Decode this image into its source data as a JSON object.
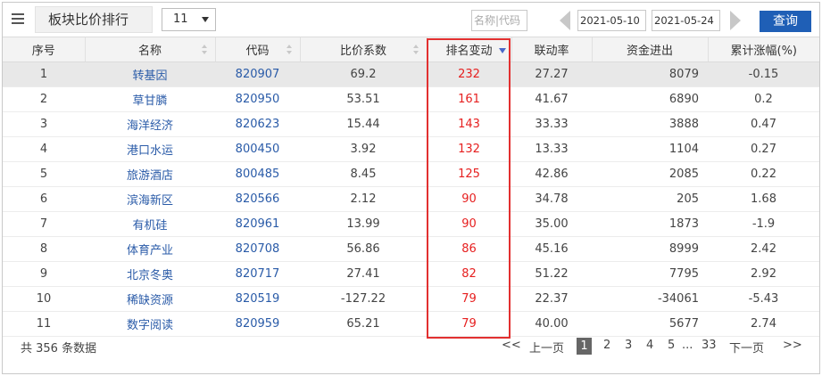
{
  "toolbar": {
    "menu_icon": "list-icon",
    "title": "板块比价排行",
    "page_size": "11",
    "search_placeholder": "名称|代码",
    "date_start": "2021-05-10",
    "date_end": "2021-05-24",
    "query_label": "查询"
  },
  "table": {
    "headers": [
      "序号",
      "名称",
      "代码",
      "比价系数",
      "排名变动",
      "联动率",
      "资金进出",
      "累计涨幅(%)"
    ],
    "rows": [
      [
        "1",
        "转基因",
        "820907",
        "69.2",
        "232",
        "27.27",
        "8079",
        "-0.15"
      ],
      [
        "2",
        "草甘膦",
        "820950",
        "53.51",
        "161",
        "41.67",
        "6890",
        "0.2"
      ],
      [
        "3",
        "海洋经济",
        "820623",
        "15.44",
        "143",
        "33.33",
        "3888",
        "0.47"
      ],
      [
        "4",
        "港口水运",
        "800450",
        "3.92",
        "132",
        "13.33",
        "1104",
        "0.27"
      ],
      [
        "5",
        "旅游酒店",
        "800485",
        "8.45",
        "125",
        "42.86",
        "2085",
        "0.22"
      ],
      [
        "6",
        "滨海新区",
        "820566",
        "2.12",
        "90",
        "34.78",
        "205",
        "1.68"
      ],
      [
        "7",
        "有机硅",
        "820961",
        "13.99",
        "90",
        "35.00",
        "1873",
        "-1.9"
      ],
      [
        "8",
        "体育产业",
        "820708",
        "56.86",
        "86",
        "45.16",
        "8999",
        "2.42"
      ],
      [
        "9",
        "北京冬奥",
        "820717",
        "27.41",
        "82",
        "51.22",
        "7795",
        "2.92"
      ],
      [
        "10",
        "稀缺资源",
        "820519",
        "-127.22",
        "79",
        "22.37",
        "-34061",
        "-5.43"
      ],
      [
        "11",
        "数字阅读",
        "820959",
        "65.21",
        "79",
        "40.00",
        "5677",
        "2.74"
      ]
    ]
  },
  "footer": {
    "total": "共 356 条数据",
    "first": "<<",
    "prev": "上一页",
    "pages": [
      "1",
      "2",
      "3",
      "4",
      "5"
    ],
    "ellipsis": "...",
    "last_page": "33",
    "next": "下一页",
    "end": ">>"
  },
  "colors": {
    "query_button": "#1f5fb6",
    "rank_text": "#e62020",
    "link_text": "#2a5ba8",
    "highlight_box": "#e23030"
  }
}
